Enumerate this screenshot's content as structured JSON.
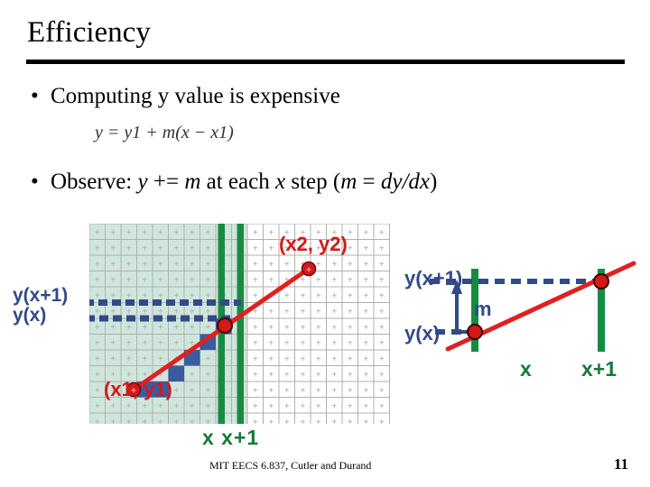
{
  "slide": {
    "title": "Efficiency",
    "bullets": [
      {
        "marker": "•",
        "text": "Computing y value is expensive"
      },
      {
        "marker": "•",
        "text_prefix": "Observe: ",
        "text_full": "Observe: y += m at each x step (m = dy/dx)"
      }
    ],
    "equation": "y = y1 + m(x − x1)",
    "footer": "MIT EECS 6.837, Cutler and Durand",
    "page_number": "11"
  },
  "bullet2_parts": {
    "observe": "Observe: ",
    "y": "y",
    "plus_eq": " += ",
    "m": "m",
    "mid": " at each ",
    "x": "x",
    "step": " step (",
    "m2": "m",
    "eq": " = ",
    "dydx": "dy/dx",
    "close": ")"
  },
  "left_figure": {
    "name": "pixel-grid-diagram",
    "labels": {
      "y_x_plus_1": "y(x+1)",
      "y_x": "y(x)",
      "point_1": "(x1, y1)",
      "point_2": "(x2, y2)",
      "x_axis": "x  x+1"
    },
    "grid": {
      "cols": 19,
      "rows": 13,
      "cell": 17.5,
      "shaded_cols": 10,
      "plus_glyph": "+"
    },
    "colors": {
      "grid_line": "#b0b0b0",
      "shaded_cell": "#cfe6dd",
      "unshaded_cell": "#ffffff",
      "plus_mark": "#a8a8a8",
      "selected_pixel": "#3a5ba0",
      "line_red": "#e02020",
      "dot_red": "#d31919",
      "dash_blue": "#334a86",
      "bar_green": "#178c41",
      "label_green": "#167a3c"
    }
  },
  "right_figure": {
    "name": "slope-increment-diagram",
    "labels": {
      "y_x_plus_1": "y(x+1)",
      "y_x": "y(x)",
      "m": "m",
      "x": "x",
      "x_plus_1": "x+1"
    },
    "colors": {
      "line_red": "#e02020",
      "dot_red": "#d31919",
      "dash_blue": "#334a86",
      "bar_green": "#178c41",
      "label_green": "#167a3c",
      "label_blue": "#334a86"
    }
  }
}
